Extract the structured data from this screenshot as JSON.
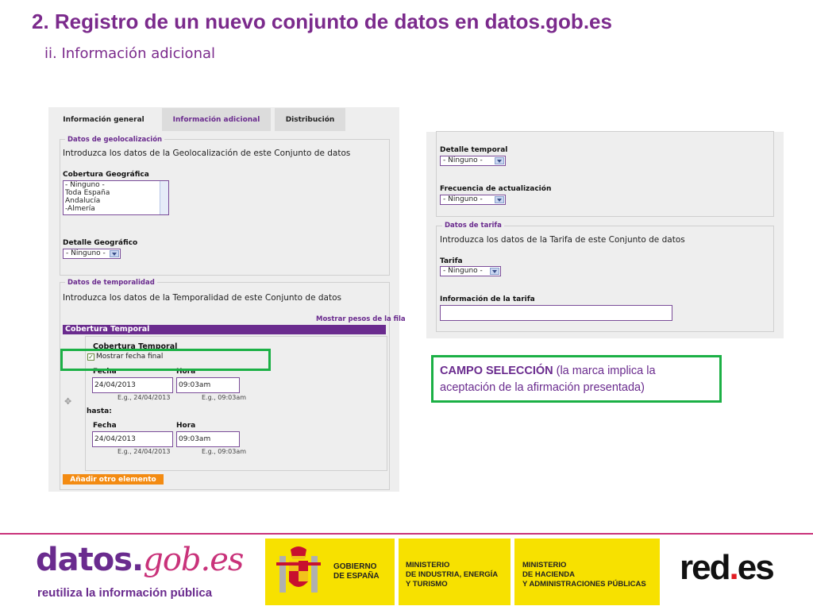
{
  "slide": {
    "title": "2. Registro de un nuevo conjunto de datos en datos.gob.es",
    "subtitle": "ii. Información adicional"
  },
  "left_form": {
    "tabs": [
      "Información general",
      "Información adicional",
      "Distribución"
    ],
    "geo": {
      "legend": "Datos de geolocalización",
      "intro": "Introduzca los datos de la Geolocalización de este Conjunto de datos",
      "coverage_label": "Cobertura Geográfica",
      "coverage_options": [
        "- Ninguno -",
        "Toda España",
        "Andalucía",
        "-Almería"
      ],
      "detail_label": "Detalle Geográfico",
      "detail_value": "- Ninguno -"
    },
    "temporal": {
      "legend": "Datos de temporalidad",
      "intro": "Introduzca los datos de la Temporalidad de este Conjunto de datos",
      "weights_link": "Mostrar pesos de la fila",
      "bar_title": "Cobertura Temporal",
      "inner_title": "Cobertura Temporal",
      "show_end_label": "Mostrar fecha final",
      "show_end_checked": true,
      "date_label": "Fecha",
      "time_label": "Hora",
      "start_date": "24/04/2013",
      "start_time": "09:03am",
      "date_hint": "E.g., 24/04/2013",
      "time_hint": "E.g., 09:03am",
      "until_label": "hasta:",
      "end_date": "24/04/2013",
      "end_time": "09:03am",
      "add_button": "Añadir otro elemento",
      "drag_icon": "drag-cross-icon"
    }
  },
  "right_form": {
    "temporal_detail_label": "Detalle temporal",
    "temporal_detail_value": "- Ninguno -",
    "frequency_label": "Frecuencia de actualización",
    "frequency_value": "- Ninguno -",
    "tariff": {
      "legend": "Datos de tarifa",
      "intro": "Introduzca los datos de la Tarifa de este Conjunto de datos",
      "tariff_label": "Tarifa",
      "tariff_value": "- Ninguno -",
      "info_label": "Información de la tarifa",
      "info_value": ""
    }
  },
  "callout": {
    "bold": "CAMPO SELECCIÓN",
    "rest": " (la marca implica la aceptación de la afirmación presentada)"
  },
  "footer": {
    "logo_part1": "datos.",
    "logo_part2": "gob.es",
    "tagline": "reutiliza la información pública",
    "gobierno": "GOBIERNO\nDE ESPAÑA",
    "ministerio1": "MINISTERIO\nDE INDUSTRIA, ENERGÍA\nY TURISMO",
    "ministerio2": "MINISTERIO\nDE HACIENDA\nY ADMINISTRACIONES PÚBLICAS",
    "rede_part1": "red",
    "rede_dot": ".",
    "rede_part2": "es"
  },
  "colors": {
    "purple": "#6a2b8e",
    "magenta": "#c9327a",
    "highlight_green": "#1bb045",
    "button_orange": "#f38b12",
    "gov_yellow": "#f7e100"
  }
}
